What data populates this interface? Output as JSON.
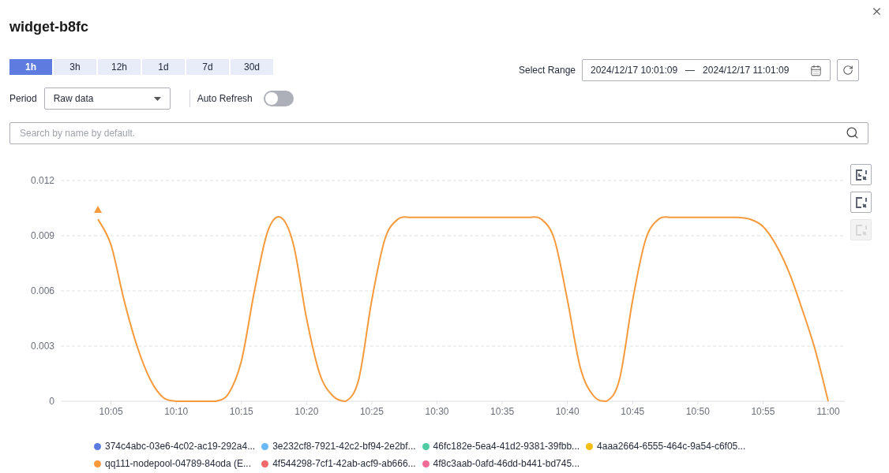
{
  "dialog": {
    "title": "widget-b8fc"
  },
  "time_tabs": [
    {
      "label": "1h",
      "selected": true
    },
    {
      "label": "3h",
      "selected": false
    },
    {
      "label": "12h",
      "selected": false
    },
    {
      "label": "1d",
      "selected": false
    },
    {
      "label": "7d",
      "selected": false
    },
    {
      "label": "30d",
      "selected": false
    }
  ],
  "range": {
    "label": "Select Range",
    "start": "2024/12/17 10:01:09",
    "separator": "—",
    "end": "2024/12/17 11:01:09"
  },
  "period": {
    "label": "Period",
    "value": "Raw data"
  },
  "auto_refresh": {
    "label": "Auto Refresh",
    "on": false
  },
  "search": {
    "placeholder": "Search by name by default."
  },
  "chart_tools": [
    {
      "kind": "zoom",
      "disabled": false
    },
    {
      "kind": "select",
      "disabled": false
    },
    {
      "kind": "reset",
      "disabled": true
    }
  ],
  "chart_data": {
    "type": "line",
    "grid": true,
    "ylim": [
      0,
      0.012
    ],
    "yticks": [
      {
        "value": 0,
        "label": "0"
      },
      {
        "value": 0.003,
        "label": "0.003"
      },
      {
        "value": 0.006,
        "label": "0.006"
      },
      {
        "value": 0.009,
        "label": "0.009"
      },
      {
        "value": 0.012,
        "label": "0.012"
      }
    ],
    "categories": [
      null,
      "10:05",
      null,
      null,
      null,
      null,
      "10:10",
      null,
      null,
      null,
      null,
      "10:15",
      null,
      null,
      null,
      null,
      "10:20",
      null,
      null,
      null,
      null,
      "10:25",
      null,
      null,
      null,
      null,
      "10:30",
      null,
      null,
      null,
      null,
      "10:35",
      null,
      null,
      null,
      null,
      "10:40",
      null,
      null,
      null,
      null,
      "10:45",
      null,
      null,
      null,
      null,
      "10:50",
      null,
      null,
      null,
      null,
      "10:55",
      null,
      null,
      null,
      null,
      "11:00"
    ],
    "series": [
      {
        "name": "374c4abc-03e6-4c02-ac19-292a4...",
        "color": "#5b7be0",
        "values": [
          null,
          null,
          null,
          null,
          null,
          null,
          null,
          null,
          null,
          null,
          null,
          null,
          null,
          null,
          null,
          null,
          null,
          null,
          null,
          null,
          null,
          null,
          null,
          null,
          null,
          null,
          null,
          null,
          null,
          null,
          null,
          null,
          null,
          null,
          null,
          null,
          null,
          null,
          null,
          null,
          null,
          null,
          null,
          null,
          null,
          null,
          null,
          null,
          null,
          null,
          null,
          null,
          null,
          null,
          null,
          null,
          null
        ]
      },
      {
        "name": "3e232cf8-7921-42c2-bf94-2e2bf...",
        "color": "#6ab9f7",
        "values": [
          null,
          null,
          null,
          null,
          null,
          null,
          null,
          null,
          null,
          null,
          null,
          null,
          null,
          null,
          null,
          null,
          null,
          null,
          null,
          null,
          null,
          null,
          null,
          null,
          null,
          null,
          null,
          null,
          null,
          null,
          null,
          null,
          null,
          null,
          null,
          null,
          null,
          null,
          null,
          null,
          null,
          null,
          null,
          null,
          null,
          null,
          null,
          null,
          null,
          null,
          null,
          null,
          null,
          null,
          null,
          null,
          null
        ]
      },
      {
        "name": "46fc182e-5ea4-41d2-9381-39fbb...",
        "color": "#4fcca3",
        "values": [
          null,
          null,
          null,
          null,
          null,
          null,
          null,
          null,
          null,
          null,
          null,
          null,
          null,
          null,
          null,
          null,
          null,
          null,
          null,
          null,
          null,
          null,
          null,
          null,
          null,
          null,
          null,
          null,
          null,
          null,
          null,
          null,
          null,
          null,
          null,
          null,
          null,
          null,
          null,
          null,
          null,
          null,
          null,
          null,
          null,
          null,
          null,
          null,
          null,
          null,
          null,
          null,
          null,
          null,
          null,
          null,
          null
        ]
      },
      {
        "name": "4aaa2664-6555-464c-9a54-c6f05...",
        "color": "#f5be15",
        "values": [
          null,
          null,
          null,
          null,
          null,
          null,
          null,
          null,
          null,
          null,
          null,
          null,
          null,
          null,
          null,
          null,
          null,
          null,
          null,
          null,
          null,
          null,
          null,
          null,
          null,
          null,
          null,
          null,
          null,
          null,
          null,
          null,
          null,
          null,
          null,
          null,
          null,
          null,
          null,
          null,
          null,
          null,
          null,
          null,
          null,
          null,
          null,
          null,
          null,
          null,
          null,
          null,
          null,
          null,
          null,
          null,
          null
        ]
      },
      {
        "name": "qq111-nodepool-04789-84oda (E...",
        "color": "#f79a3c",
        "values": [
          0.0099,
          0.0085,
          0.0055,
          0.003,
          0.0012,
          0.0002,
          0,
          0,
          0,
          0,
          0.0004,
          0.0022,
          0.006,
          0.0092,
          0.01,
          0.0085,
          0.0045,
          0.0015,
          0.0003,
          0,
          0.0012,
          0.0055,
          0.0088,
          0.0099,
          0.01,
          0.01,
          0.01,
          0.01,
          0.01,
          0.01,
          0.01,
          0.01,
          0.01,
          0.01,
          0.0099,
          0.0088,
          0.0055,
          0.0018,
          0.0003,
          0,
          0.0012,
          0.0055,
          0.0088,
          0.0099,
          0.01,
          0.01,
          0.01,
          0.01,
          0.01,
          0.01,
          0.0099,
          0.0095,
          0.0085,
          0.007,
          0.005,
          0.0028,
          0
        ]
      },
      {
        "name": "4f544298-7cf1-42ab-acf9-ab666...",
        "color": "#f0686a",
        "values": [
          null,
          null,
          null,
          null,
          null,
          null,
          null,
          null,
          null,
          null,
          null,
          null,
          null,
          null,
          null,
          null,
          null,
          null,
          null,
          null,
          null,
          null,
          null,
          null,
          null,
          null,
          null,
          null,
          null,
          null,
          null,
          null,
          null,
          null,
          null,
          null,
          null,
          null,
          null,
          null,
          null,
          null,
          null,
          null,
          null,
          null,
          null,
          null,
          null,
          null,
          null,
          null,
          null,
          null,
          null,
          null,
          null
        ]
      },
      {
        "name": "4f8c3aab-0afd-46dd-b441-bd745...",
        "color": "#f06a98",
        "values": [
          null,
          null,
          null,
          null,
          null,
          null,
          null,
          null,
          null,
          null,
          null,
          null,
          null,
          null,
          null,
          null,
          null,
          null,
          null,
          null,
          null,
          null,
          null,
          null,
          null,
          null,
          null,
          null,
          null,
          null,
          null,
          null,
          null,
          null,
          null,
          null,
          null,
          null,
          null,
          null,
          null,
          null,
          null,
          null,
          null,
          null,
          null,
          null,
          null,
          null,
          null,
          null,
          null,
          null,
          null,
          null,
          null
        ]
      }
    ]
  }
}
